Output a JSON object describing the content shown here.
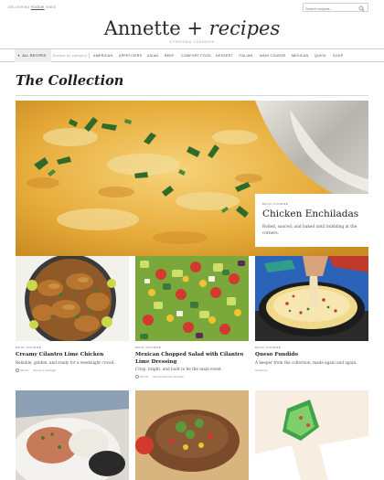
{
  "topbar": {
    "text_before": "DELIVERING ",
    "text_link": "FOODIE",
    "text_after": " VIBES",
    "search_placeholder": "Search recipes..."
  },
  "masthead": {
    "logo_name": "Annette",
    "logo_plus": "+",
    "logo_script": "recipes",
    "tagline": "A PERSONAL COOKBOOK"
  },
  "nav": {
    "active": "ALL RECIPES",
    "browse": "Browse by category:",
    "items": [
      "AMERICAN",
      "APPETIZERS",
      "ASIAN",
      "BEEF",
      "COMFORT FOOD",
      "DESSERT",
      "ITALIAN",
      "MAIN COURSE",
      "MEXICAN",
      "QUICK",
      "SOUP"
    ]
  },
  "section": {
    "title": "The Collection"
  },
  "hero": {
    "category": "MAIN COURSE",
    "title": "Chicken Enchiladas",
    "description": "Rolled, sauced, and baked until bubbling at the corners."
  },
  "cards": [
    {
      "category": "MAIN COURSE",
      "title": "Creamy Cilantro Lime Chicken",
      "description": "Reliable, golden, and ready for a weeknight crowd.",
      "time": "40 min",
      "serves": "Serves 4 servings"
    },
    {
      "category": "MAIN COURSE",
      "title": "Mexican Chopped Salad with Cilantro Lime Dressing",
      "description": "Crisp, bright, and built to be the main event.",
      "time": "20 min",
      "serves": "Serves About 6 servings"
    },
    {
      "category": "MAIN COURSE",
      "title": "Queso Fundido",
      "description": "A keeper from the collection, made again and again.",
      "serves": "Serves 6+"
    }
  ],
  "colors": {
    "accent": "#2a2a2a",
    "rule": "#d8d8d8",
    "nav_active_bg": "#eeeeee",
    "muted": "#888888"
  },
  "icons": {
    "search": "search-icon",
    "active_nav": "star-icon",
    "time": "clock-icon"
  }
}
